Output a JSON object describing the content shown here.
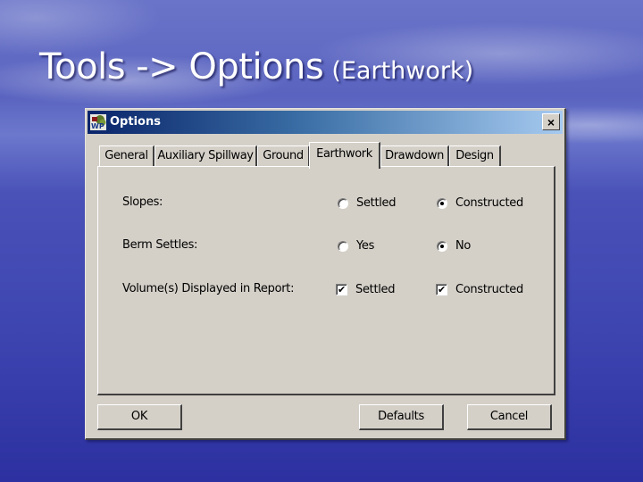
{
  "slide": {
    "title_main": "Tools -> Options",
    "title_sub": "(Earthwork)"
  },
  "dialog": {
    "title": "Options",
    "close_icon": "×",
    "tabs": [
      {
        "label": "General",
        "active": false
      },
      {
        "label": "Auxiliary Spillway",
        "active": false
      },
      {
        "label": "Ground",
        "active": false
      },
      {
        "label": "Earthwork",
        "active": true
      },
      {
        "label": "Drawdown",
        "active": false
      },
      {
        "label": "Design",
        "active": false
      }
    ],
    "rows": [
      {
        "label": "Slopes:",
        "type": "radio",
        "options": [
          {
            "label": "Settled",
            "checked": false
          },
          {
            "label": "Constructed",
            "checked": true
          }
        ]
      },
      {
        "label": "Berm Settles:",
        "type": "radio",
        "options": [
          {
            "label": "Yes",
            "checked": false
          },
          {
            "label": "No",
            "checked": true
          }
        ]
      },
      {
        "label": "Volume(s) Displayed in Report:",
        "type": "checkbox",
        "options": [
          {
            "label": "Settled",
            "checked": true
          },
          {
            "label": "Constructed",
            "checked": true
          }
        ]
      }
    ],
    "check_glyph": "✔",
    "buttons": {
      "ok": "OK",
      "defaults": "Defaults",
      "cancel": "Cancel"
    }
  }
}
